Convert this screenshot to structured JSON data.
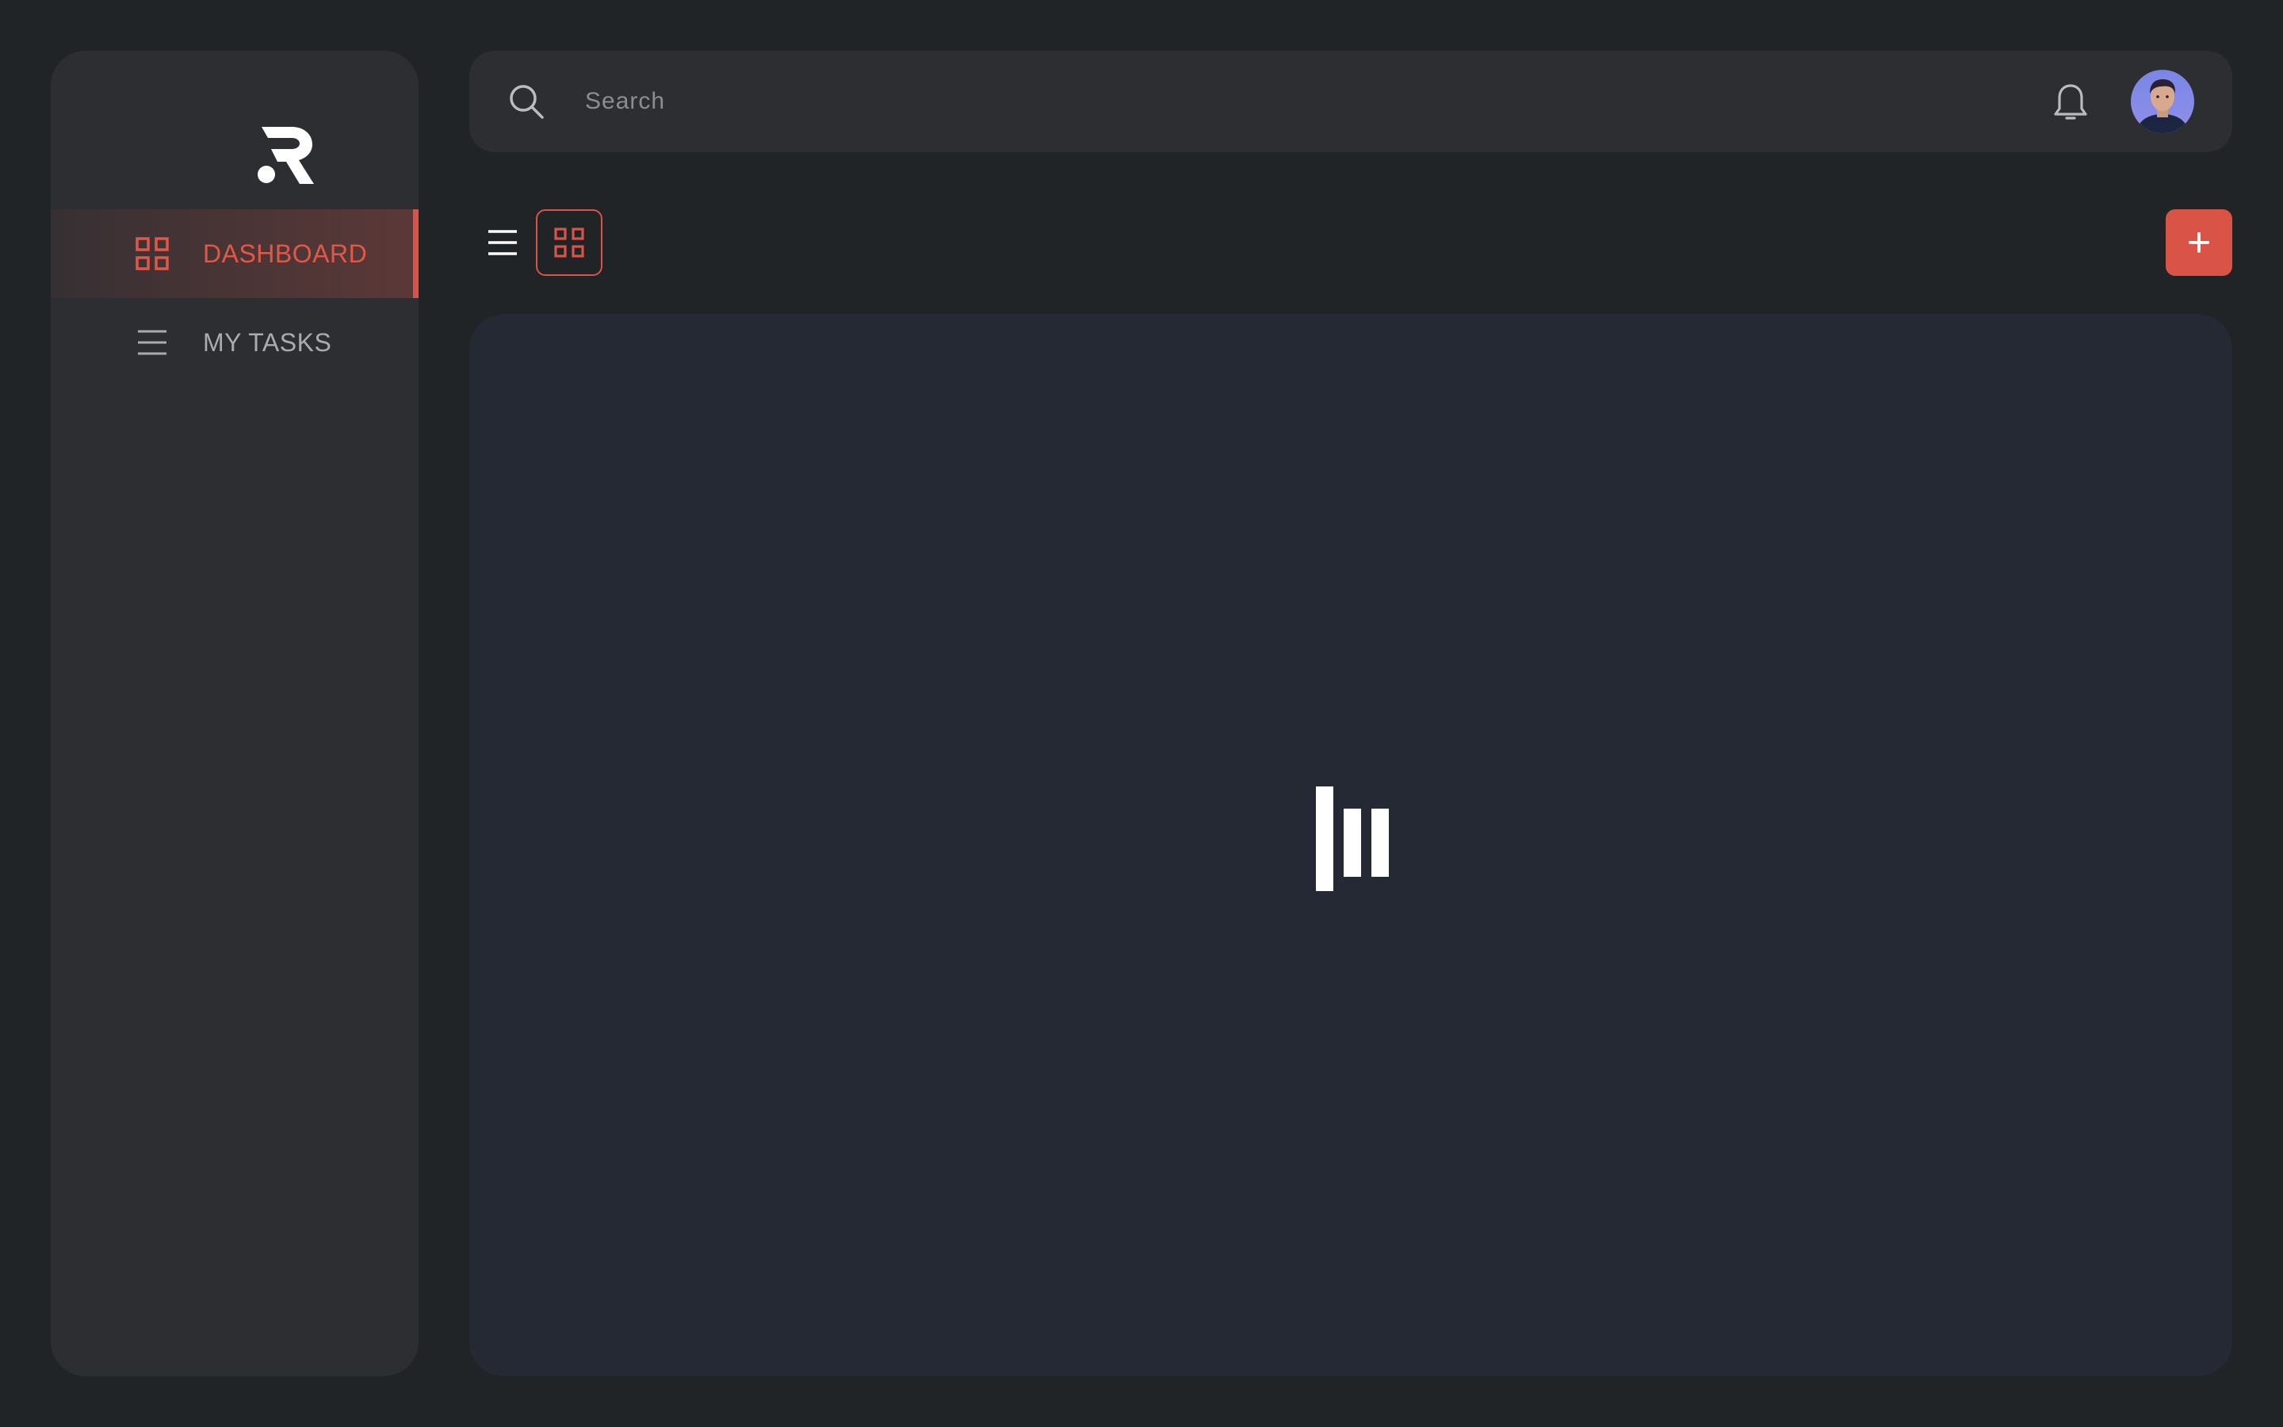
{
  "sidebar": {
    "logo": "R",
    "items": [
      {
        "label": "DASHBOARD",
        "icon": "grid-icon",
        "active": true
      },
      {
        "label": "MY TASKS",
        "icon": "list-icon",
        "active": false
      }
    ]
  },
  "header": {
    "search": {
      "placeholder": "Search",
      "value": ""
    },
    "icons": [
      "search-icon",
      "bell-icon",
      "avatar"
    ]
  },
  "toolbar": {
    "views": [
      "list-view",
      "grid-view"
    ],
    "active_view": "grid-view",
    "add_label": "+"
  },
  "main": {
    "state": "loading"
  },
  "colors": {
    "background": "#212427",
    "panel": "#2c2e32",
    "content": "#242934",
    "accent": "#d95346",
    "text_muted": "#a8abb0"
  }
}
